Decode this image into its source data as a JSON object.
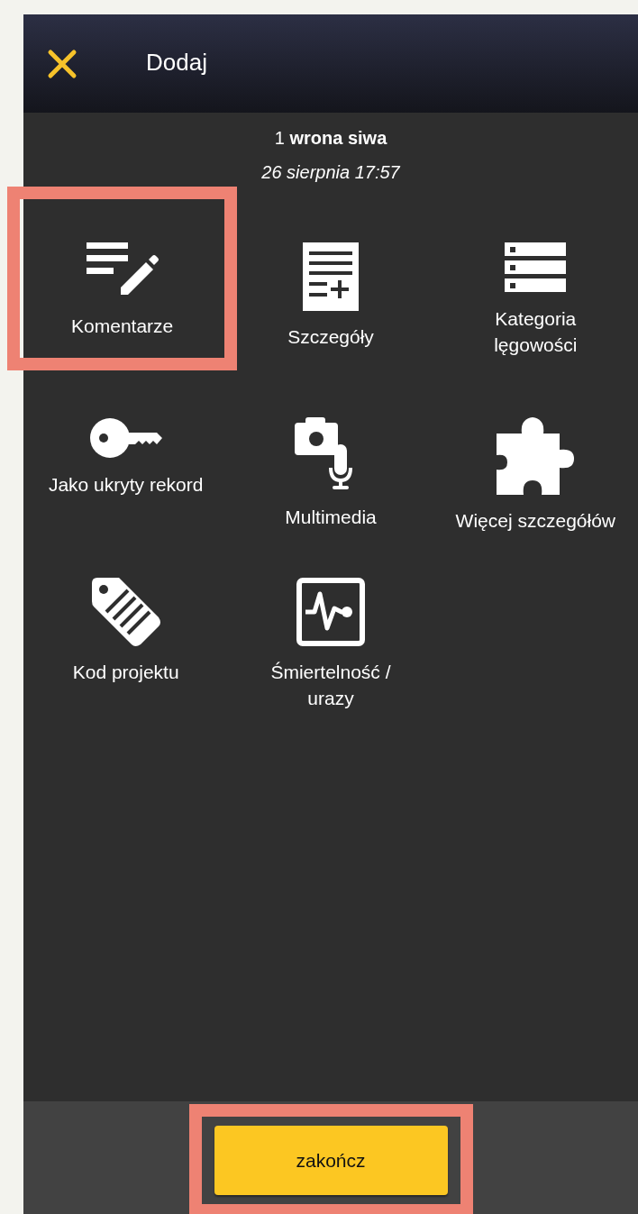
{
  "header": {
    "title": "Dodaj"
  },
  "record": {
    "species": "1 **wrona siwa**",
    "datetime": "26 sierpnia 17:57"
  },
  "options": [
    {
      "label": "Komentarze",
      "kind": "comments",
      "highlighted": true
    },
    {
      "label": "Szczegóły",
      "kind": "details",
      "highlighted": false
    },
    {
      "label": "Kategoria lęgowości",
      "kind": "breeding",
      "highlighted": false
    },
    {
      "label": "Jako ukryty rekord",
      "kind": "hidden",
      "highlighted": false
    },
    {
      "label": "Multimedia",
      "kind": "media",
      "highlighted": false
    },
    {
      "label": "Więcej szczegółów",
      "kind": "more",
      "highlighted": false
    },
    {
      "label": "Kod projektu",
      "kind": "project",
      "highlighted": false
    },
    {
      "label": "Śmiertelność / urazy",
      "kind": "mortality",
      "highlighted": false
    }
  ],
  "footer": {
    "button": "zakończ",
    "highlighted": true
  }
}
